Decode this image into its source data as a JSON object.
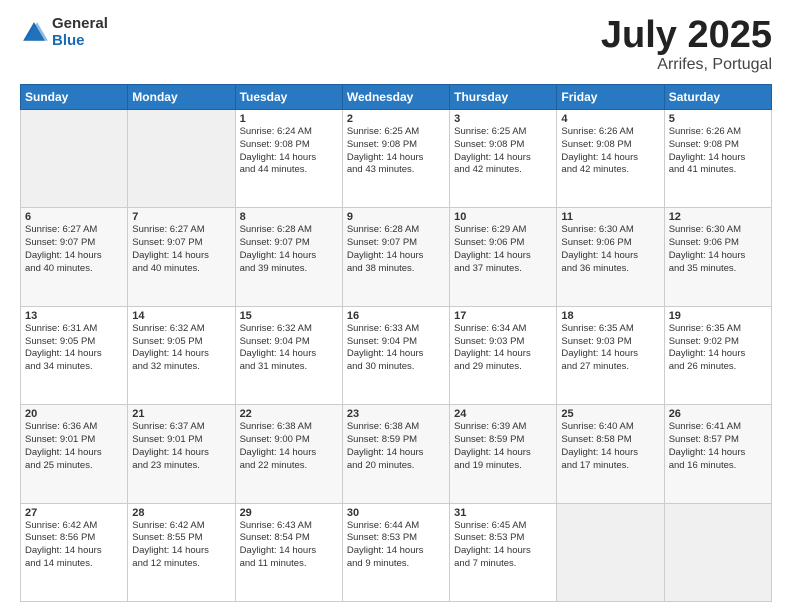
{
  "logo": {
    "general": "General",
    "blue": "Blue"
  },
  "title": {
    "month": "July 2025",
    "location": "Arrifes, Portugal"
  },
  "weekdays": [
    "Sunday",
    "Monday",
    "Tuesday",
    "Wednesday",
    "Thursday",
    "Friday",
    "Saturday"
  ],
  "weeks": [
    [
      {
        "day": "",
        "info": ""
      },
      {
        "day": "",
        "info": ""
      },
      {
        "day": "1",
        "info": "Sunrise: 6:24 AM\nSunset: 9:08 PM\nDaylight: 14 hours\nand 44 minutes."
      },
      {
        "day": "2",
        "info": "Sunrise: 6:25 AM\nSunset: 9:08 PM\nDaylight: 14 hours\nand 43 minutes."
      },
      {
        "day": "3",
        "info": "Sunrise: 6:25 AM\nSunset: 9:08 PM\nDaylight: 14 hours\nand 42 minutes."
      },
      {
        "day": "4",
        "info": "Sunrise: 6:26 AM\nSunset: 9:08 PM\nDaylight: 14 hours\nand 42 minutes."
      },
      {
        "day": "5",
        "info": "Sunrise: 6:26 AM\nSunset: 9:08 PM\nDaylight: 14 hours\nand 41 minutes."
      }
    ],
    [
      {
        "day": "6",
        "info": "Sunrise: 6:27 AM\nSunset: 9:07 PM\nDaylight: 14 hours\nand 40 minutes."
      },
      {
        "day": "7",
        "info": "Sunrise: 6:27 AM\nSunset: 9:07 PM\nDaylight: 14 hours\nand 40 minutes."
      },
      {
        "day": "8",
        "info": "Sunrise: 6:28 AM\nSunset: 9:07 PM\nDaylight: 14 hours\nand 39 minutes."
      },
      {
        "day": "9",
        "info": "Sunrise: 6:28 AM\nSunset: 9:07 PM\nDaylight: 14 hours\nand 38 minutes."
      },
      {
        "day": "10",
        "info": "Sunrise: 6:29 AM\nSunset: 9:06 PM\nDaylight: 14 hours\nand 37 minutes."
      },
      {
        "day": "11",
        "info": "Sunrise: 6:30 AM\nSunset: 9:06 PM\nDaylight: 14 hours\nand 36 minutes."
      },
      {
        "day": "12",
        "info": "Sunrise: 6:30 AM\nSunset: 9:06 PM\nDaylight: 14 hours\nand 35 minutes."
      }
    ],
    [
      {
        "day": "13",
        "info": "Sunrise: 6:31 AM\nSunset: 9:05 PM\nDaylight: 14 hours\nand 34 minutes."
      },
      {
        "day": "14",
        "info": "Sunrise: 6:32 AM\nSunset: 9:05 PM\nDaylight: 14 hours\nand 32 minutes."
      },
      {
        "day": "15",
        "info": "Sunrise: 6:32 AM\nSunset: 9:04 PM\nDaylight: 14 hours\nand 31 minutes."
      },
      {
        "day": "16",
        "info": "Sunrise: 6:33 AM\nSunset: 9:04 PM\nDaylight: 14 hours\nand 30 minutes."
      },
      {
        "day": "17",
        "info": "Sunrise: 6:34 AM\nSunset: 9:03 PM\nDaylight: 14 hours\nand 29 minutes."
      },
      {
        "day": "18",
        "info": "Sunrise: 6:35 AM\nSunset: 9:03 PM\nDaylight: 14 hours\nand 27 minutes."
      },
      {
        "day": "19",
        "info": "Sunrise: 6:35 AM\nSunset: 9:02 PM\nDaylight: 14 hours\nand 26 minutes."
      }
    ],
    [
      {
        "day": "20",
        "info": "Sunrise: 6:36 AM\nSunset: 9:01 PM\nDaylight: 14 hours\nand 25 minutes."
      },
      {
        "day": "21",
        "info": "Sunrise: 6:37 AM\nSunset: 9:01 PM\nDaylight: 14 hours\nand 23 minutes."
      },
      {
        "day": "22",
        "info": "Sunrise: 6:38 AM\nSunset: 9:00 PM\nDaylight: 14 hours\nand 22 minutes."
      },
      {
        "day": "23",
        "info": "Sunrise: 6:38 AM\nSunset: 8:59 PM\nDaylight: 14 hours\nand 20 minutes."
      },
      {
        "day": "24",
        "info": "Sunrise: 6:39 AM\nSunset: 8:59 PM\nDaylight: 14 hours\nand 19 minutes."
      },
      {
        "day": "25",
        "info": "Sunrise: 6:40 AM\nSunset: 8:58 PM\nDaylight: 14 hours\nand 17 minutes."
      },
      {
        "day": "26",
        "info": "Sunrise: 6:41 AM\nSunset: 8:57 PM\nDaylight: 14 hours\nand 16 minutes."
      }
    ],
    [
      {
        "day": "27",
        "info": "Sunrise: 6:42 AM\nSunset: 8:56 PM\nDaylight: 14 hours\nand 14 minutes."
      },
      {
        "day": "28",
        "info": "Sunrise: 6:42 AM\nSunset: 8:55 PM\nDaylight: 14 hours\nand 12 minutes."
      },
      {
        "day": "29",
        "info": "Sunrise: 6:43 AM\nSunset: 8:54 PM\nDaylight: 14 hours\nand 11 minutes."
      },
      {
        "day": "30",
        "info": "Sunrise: 6:44 AM\nSunset: 8:53 PM\nDaylight: 14 hours\nand 9 minutes."
      },
      {
        "day": "31",
        "info": "Sunrise: 6:45 AM\nSunset: 8:53 PM\nDaylight: 14 hours\nand 7 minutes."
      },
      {
        "day": "",
        "info": ""
      },
      {
        "day": "",
        "info": ""
      }
    ]
  ]
}
